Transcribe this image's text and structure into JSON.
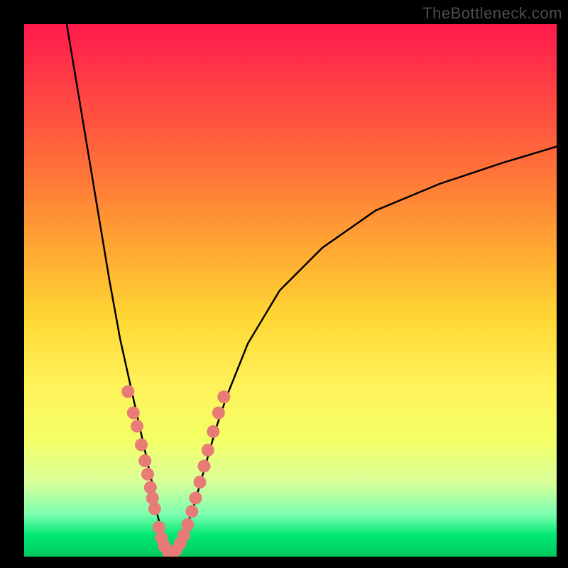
{
  "watermark": "TheBottleneck.com",
  "chart_data": {
    "type": "line",
    "title": "",
    "xlabel": "",
    "ylabel": "",
    "xlim": [
      0,
      100
    ],
    "ylim": [
      0,
      100
    ],
    "background_gradient": {
      "top": "#ff1a4d",
      "mid": "#ffd633",
      "low": "#f4ff66",
      "band": "#00e872",
      "bottom": "#00c95f"
    },
    "series": [
      {
        "name": "bottleneck-curve",
        "stroke": "#000000",
        "x": [
          8,
          10,
          12,
          14,
          16,
          18,
          20,
          22,
          24,
          25,
          26,
          27,
          28,
          29,
          30,
          32,
          34,
          36,
          38,
          42,
          48,
          56,
          66,
          78,
          90,
          100
        ],
        "values": [
          100,
          88,
          76,
          64,
          52,
          41,
          32,
          23,
          14,
          8,
          4,
          1,
          0.5,
          1,
          4,
          10,
          17,
          24,
          30,
          40,
          50,
          58,
          65,
          70,
          74,
          77
        ]
      }
    ],
    "scatter": {
      "name": "sample-dots",
      "fill": "#e87b75",
      "points": [
        {
          "x": 19.5,
          "y": 31
        },
        {
          "x": 20.5,
          "y": 27
        },
        {
          "x": 21.2,
          "y": 24.5
        },
        {
          "x": 22.0,
          "y": 21
        },
        {
          "x": 22.7,
          "y": 18
        },
        {
          "x": 23.2,
          "y": 15.5
        },
        {
          "x": 23.7,
          "y": 13
        },
        {
          "x": 24.1,
          "y": 11
        },
        {
          "x": 24.5,
          "y": 9
        },
        {
          "x": 25.3,
          "y": 5.5
        },
        {
          "x": 25.8,
          "y": 3.5
        },
        {
          "x": 26.3,
          "y": 2
        },
        {
          "x": 27.0,
          "y": 1
        },
        {
          "x": 27.8,
          "y": 0.8
        },
        {
          "x": 28.5,
          "y": 1.2
        },
        {
          "x": 29.3,
          "y": 2.5
        },
        {
          "x": 30.0,
          "y": 4
        },
        {
          "x": 30.7,
          "y": 6
        },
        {
          "x": 31.5,
          "y": 8.5
        },
        {
          "x": 32.2,
          "y": 11
        },
        {
          "x": 33.0,
          "y": 14
        },
        {
          "x": 33.8,
          "y": 17
        },
        {
          "x": 34.5,
          "y": 20
        },
        {
          "x": 35.5,
          "y": 23.5
        },
        {
          "x": 36.5,
          "y": 27
        },
        {
          "x": 37.5,
          "y": 30
        }
      ]
    }
  }
}
